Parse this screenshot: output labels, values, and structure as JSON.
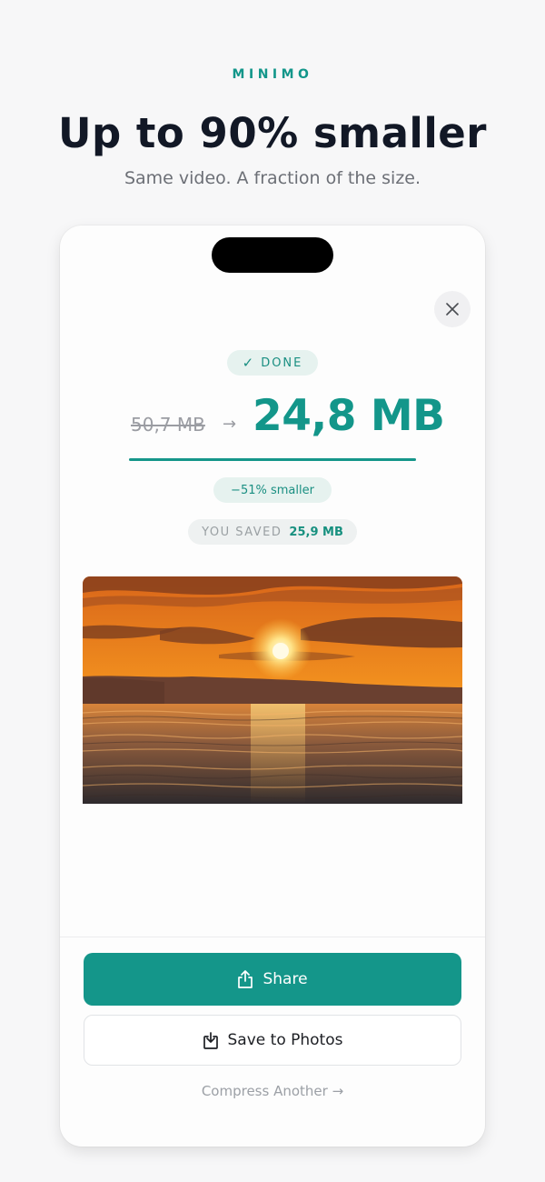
{
  "header": {
    "brand": "MINIMO",
    "headline": "Up to 90% smaller",
    "subhead": "Same video. A fraction of the size."
  },
  "result": {
    "status": "DONE",
    "original_size": "50,7 MB",
    "arrow": "→",
    "compressed_size": "24,8 MB",
    "progress": 1.0,
    "reduction": "−51% smaller",
    "saved_label": "YOU SAVED",
    "saved_value": "25,9 MB"
  },
  "actions": {
    "share_label": "Share",
    "save_label": "Save to Photos",
    "compress_another_label": "Compress Another →"
  },
  "icons": {
    "close": "close-icon",
    "check": "check-icon",
    "share": "share-icon",
    "save": "save-to-photos-icon"
  },
  "colors": {
    "accent": "#14968a",
    "title": "#121826",
    "muted": "#9a9ca2"
  }
}
